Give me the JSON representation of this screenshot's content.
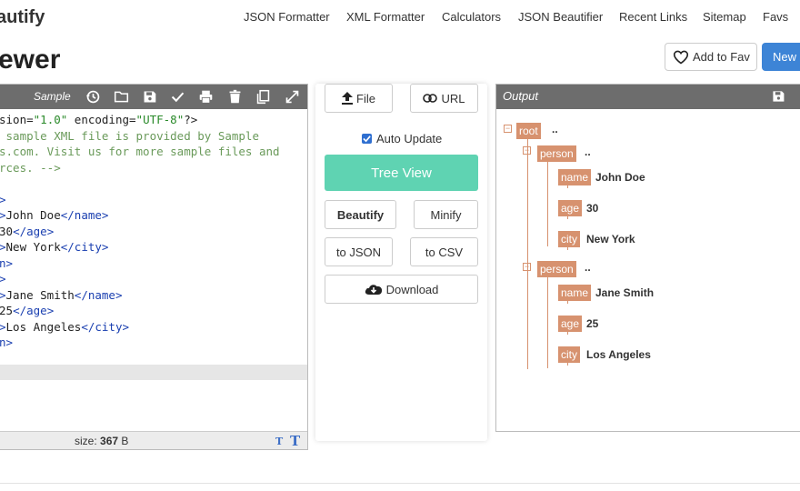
{
  "header": {
    "brand": "autify",
    "nav": [
      "JSON Formatter",
      "XML Formatter",
      "Calculators",
      "JSON Beautifier",
      "Recent Links",
      "Sitemap",
      "Favs"
    ],
    "page_title": "ewer",
    "add_fav_label": "Add to Fav",
    "new_label": "New"
  },
  "editor": {
    "sample_label": "Sample",
    "lines": [
      [
        [
          "sion=",
          "c-attr"
        ],
        [
          "\"1.0\"",
          "c-str"
        ],
        [
          " encoding=",
          "c-attr"
        ],
        [
          "\"UTF-8\"",
          "c-str"
        ],
        [
          "?>",
          "c-attr"
        ]
      ],
      [
        [
          " sample XML file is provided by Sample",
          "c-com"
        ]
      ],
      [
        [
          "s.com. Visit us for more sample files and",
          "c-com"
        ]
      ],
      [
        [
          "rces. -->",
          "c-com"
        ]
      ],
      [],
      [
        [
          ">",
          "c-tag"
        ]
      ],
      [
        [
          ">",
          "c-tag"
        ],
        [
          "John Doe",
          "c-attr"
        ],
        [
          "</name>",
          "c-tag"
        ]
      ],
      [
        [
          "30",
          "c-attr"
        ],
        [
          "</age>",
          "c-tag"
        ]
      ],
      [
        [
          ">",
          "c-tag"
        ],
        [
          "New York",
          "c-attr"
        ],
        [
          "</city>",
          "c-tag"
        ]
      ],
      [
        [
          "n>",
          "c-tag"
        ]
      ],
      [
        [
          ">",
          "c-tag"
        ]
      ],
      [
        [
          ">",
          "c-tag"
        ],
        [
          "Jane Smith",
          "c-attr"
        ],
        [
          "</name>",
          "c-tag"
        ]
      ],
      [
        [
          "25",
          "c-attr"
        ],
        [
          "</age>",
          "c-tag"
        ]
      ],
      [
        [
          ">",
          "c-tag"
        ],
        [
          "Los Angeles",
          "c-attr"
        ],
        [
          "</city>",
          "c-tag"
        ]
      ],
      [
        [
          "n>",
          "c-tag"
        ]
      ]
    ],
    "size_label": "size:",
    "size_value": "367",
    "size_unit": "B"
  },
  "actions": {
    "file_label": "File",
    "url_label": "URL",
    "auto_update_label": "Auto Update",
    "auto_update_checked": true,
    "tree_view_label": "Tree View",
    "beautify_label": "Beautify",
    "minify_label": "Minify",
    "to_json_label": "to JSON",
    "to_csv_label": "to CSV",
    "download_label": "Download"
  },
  "output": {
    "label": "Output",
    "root_tag": "root",
    "ellipsis": "..",
    "persons": [
      {
        "tag": "person",
        "fields": [
          {
            "tag": "name",
            "value": "John Doe"
          },
          {
            "tag": "age",
            "value": "30"
          },
          {
            "tag": "city",
            "value": "New York"
          }
        ]
      },
      {
        "tag": "person",
        "fields": [
          {
            "tag": "name",
            "value": "Jane Smith"
          },
          {
            "tag": "age",
            "value": "25"
          },
          {
            "tag": "city",
            "value": "Los Angeles"
          }
        ]
      }
    ]
  },
  "colors": {
    "accent_blue": "#3d84d6",
    "tree_button": "#5fd3b2",
    "tag_color": "#d7926f",
    "toolbar_gray": "#6d6d6d"
  }
}
